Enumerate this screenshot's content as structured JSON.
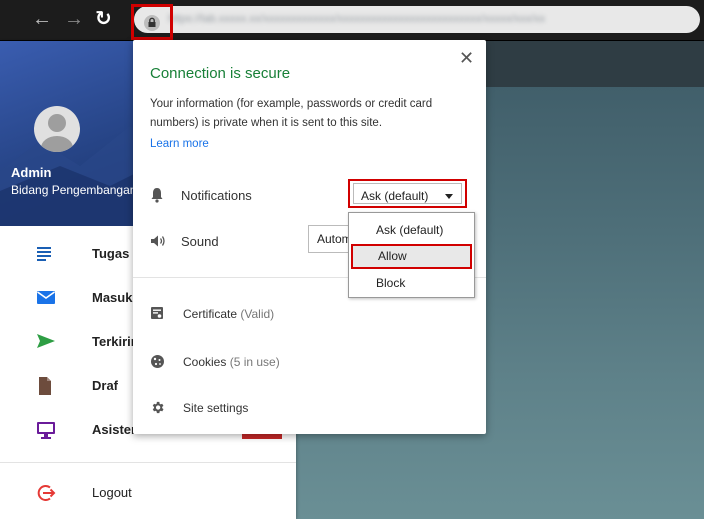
{
  "sidebar": {
    "user_name": "Admin",
    "user_dept": "Bidang Pengembangan",
    "items": [
      {
        "label": "Tugas",
        "icon": "list-icon"
      },
      {
        "label": "Masuk",
        "icon": "mail-icon"
      },
      {
        "label": "Terkirim",
        "icon": "send-icon"
      },
      {
        "label": "Draf",
        "icon": "draft-file-icon"
      },
      {
        "label": "Asisten",
        "icon": "monitor-icon"
      }
    ],
    "logout": "Logout"
  },
  "popup": {
    "title": "Connection is secure",
    "description": "Your information (for example, passwords or credit card numbers) is private when it is sent to this site.",
    "learn_more": "Learn more",
    "notifications_label": "Notifications",
    "notifications_value": "Ask (default)",
    "sound_label": "Sound",
    "sound_value": "Automatic",
    "certificate_label": "Certificate",
    "certificate_status": "(Valid)",
    "cookies_label": "Cookies",
    "cookies_status": "(5 in use)",
    "site_settings": "Site settings"
  },
  "dropdown": {
    "options": [
      "Ask (default)",
      "Allow",
      "Block"
    ],
    "highlighted": "Allow"
  },
  "colors": {
    "secure_green": "#188038",
    "link_blue": "#1a73e8",
    "highlight_red": "#d10000"
  }
}
